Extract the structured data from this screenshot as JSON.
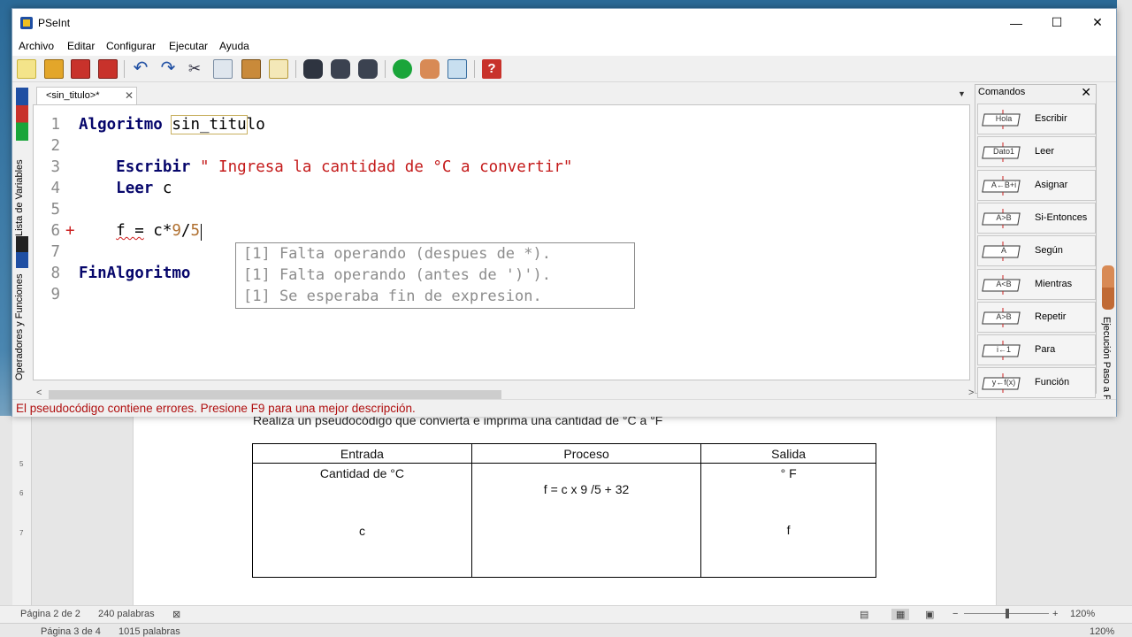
{
  "window": {
    "title": "PSeInt",
    "buttons": {
      "minimize": "—",
      "maximize": "☐",
      "close": "✕"
    }
  },
  "menu": [
    "Archivo",
    "Editar",
    "Configurar",
    "Ejecutar",
    "Ayuda"
  ],
  "toolbar_icons": [
    "new-file-icon",
    "open-file-icon",
    "save-icon",
    "save-as-icon",
    "undo-icon",
    "redo-icon",
    "cut-icon",
    "copy-icon",
    "paste-icon",
    "indent-icon",
    "find-icon",
    "find-prev-icon",
    "find-next-icon",
    "run-icon",
    "step-by-step-icon",
    "flowchart-icon",
    "help-icon"
  ],
  "left_tabs": {
    "variables": "Lista de Variables",
    "operators": "Operadores y Funciones"
  },
  "editor": {
    "tab_label": "<sin_titulo>*",
    "tab_close": "✕",
    "lines": [
      {
        "n": "1",
        "marker": "",
        "parts": [
          {
            "t": "Algoritmo",
            "c": "kw"
          },
          {
            "t": " ",
            "c": "ident"
          },
          {
            "t": "sin_titu",
            "c": "ident boxed"
          },
          {
            "t": "lo",
            "c": "ident"
          }
        ]
      },
      {
        "n": "2",
        "marker": "",
        "parts": []
      },
      {
        "n": "3",
        "marker": "",
        "parts": [
          {
            "t": "    ",
            "c": "ident"
          },
          {
            "t": "Escribir",
            "c": "kw"
          },
          {
            "t": " \" Ingresa la cantidad de °C a convertir\"",
            "c": "str"
          }
        ]
      },
      {
        "n": "4",
        "marker": "",
        "parts": [
          {
            "t": "    ",
            "c": "ident"
          },
          {
            "t": "Leer",
            "c": "kw"
          },
          {
            "t": " c",
            "c": "ident"
          }
        ]
      },
      {
        "n": "5",
        "marker": "",
        "parts": []
      },
      {
        "n": "6",
        "marker": "+",
        "parts": [
          {
            "t": "    ",
            "c": "ident"
          },
          {
            "t": "f =",
            "c": "ident squiggle"
          },
          {
            "t": " c*",
            "c": "ident"
          },
          {
            "t": "9",
            "c": "num"
          },
          {
            "t": "/",
            "c": "ident"
          },
          {
            "t": "5",
            "c": "num"
          }
        ]
      },
      {
        "n": "7",
        "marker": "",
        "parts": []
      },
      {
        "n": "8",
        "marker": "",
        "parts": [
          {
            "t": "FinAlgoritmo",
            "c": "kw"
          }
        ]
      },
      {
        "n": "9",
        "marker": "",
        "parts": []
      }
    ],
    "errors": [
      "[1] Falta operando (despues de *).",
      "[1] Falta operando (antes de ')').",
      "[1] Se esperaba fin de expresion."
    ]
  },
  "commands": {
    "title": "Comandos",
    "close": "✕",
    "items": [
      {
        "label": "Escribir",
        "icon": "escribir-icon",
        "glyph": "Hola"
      },
      {
        "label": "Leer",
        "icon": "leer-icon",
        "glyph": "Dato1"
      },
      {
        "label": "Asignar",
        "icon": "asignar-icon",
        "glyph": "A←B+i"
      },
      {
        "label": "Si-Entonces",
        "icon": "si-entonces-icon",
        "glyph": "A>B"
      },
      {
        "label": "Según",
        "icon": "segun-icon",
        "glyph": "A"
      },
      {
        "label": "Mientras",
        "icon": "mientras-icon",
        "glyph": "A<B"
      },
      {
        "label": "Repetir",
        "icon": "repetir-icon",
        "glyph": "A>B"
      },
      {
        "label": "Para",
        "icon": "para-icon",
        "glyph": "i←1"
      },
      {
        "label": "Función",
        "icon": "funcion-icon",
        "glyph": "y←f(x)"
      }
    ]
  },
  "right_tab": "Ejecución Paso a Paso",
  "status": "El pseudocódigo contiene errores. Presione F9 para una mejor descripción.",
  "word": {
    "heading": "Realiza un pseudocódigo que convierta e imprima una cantidad de °C a °F",
    "table": {
      "headers": [
        "Entrada",
        "Proceso",
        "Salida"
      ],
      "entrada": [
        "Cantidad de °C",
        "c"
      ],
      "proceso": [
        "f = c x 9 /5 + 32"
      ],
      "salida": [
        "° F",
        "f"
      ]
    },
    "status1": {
      "page": "Página 2 de 2",
      "words": "240 palabras",
      "zoom": "120%"
    },
    "status2": {
      "page": "Página 3 de 4",
      "words": "1015 palabras",
      "zoom": "120%"
    },
    "ruler_ticks": [
      "5",
      "6",
      "7"
    ]
  },
  "colors": {
    "keyword": "#06066b",
    "string": "#c41a1a",
    "error_status": "#b01010",
    "run_button": "#1aa53a"
  }
}
